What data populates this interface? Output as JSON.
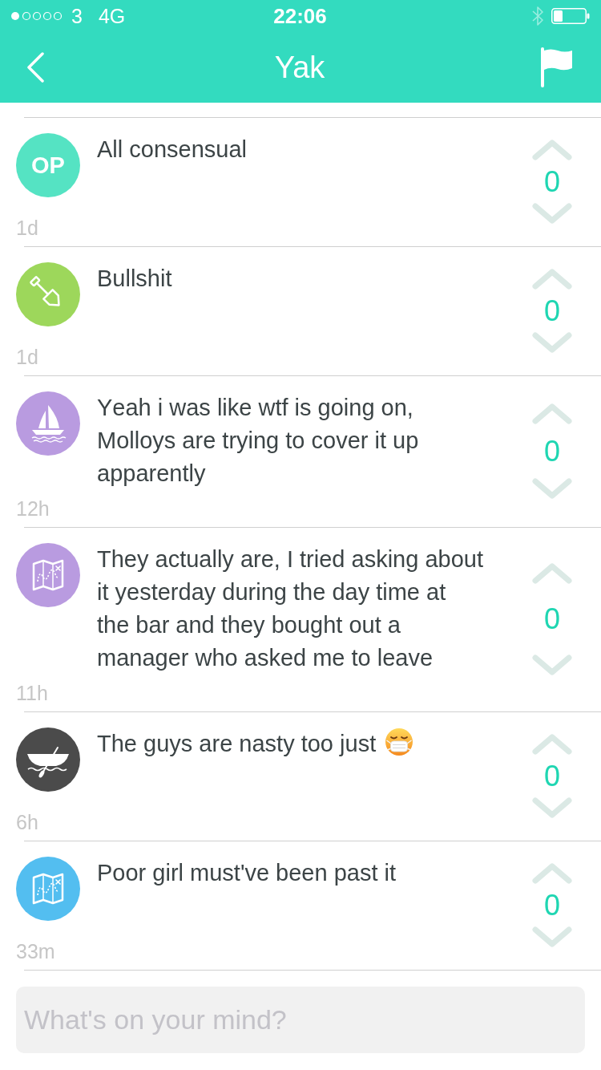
{
  "status_bar": {
    "carrier": "3",
    "network": "4G",
    "time": "22:06"
  },
  "nav_bar": {
    "title": "Yak"
  },
  "posts": [
    {
      "avatar": {
        "kind": "text",
        "label": "OP",
        "color": "#55e3c3"
      },
      "text": "All consensual",
      "time": "1d",
      "votes": "0"
    },
    {
      "avatar": {
        "kind": "shovel",
        "color": "#9dd75b"
      },
      "text": "Bullshit",
      "time": "1d",
      "votes": "0"
    },
    {
      "avatar": {
        "kind": "sailboat",
        "color": "#b99be0"
      },
      "text": "Yeah i was like wtf is going on, Molloys are trying to cover it up apparently",
      "time": "12h",
      "votes": "0"
    },
    {
      "avatar": {
        "kind": "map",
        "color": "#b99be0"
      },
      "text": "They actually are, I tried asking about it yesterday during the day time at the bar and they bought out a manager who asked me to leave",
      "time": "11h",
      "votes": "0"
    },
    {
      "avatar": {
        "kind": "canoe",
        "color": "#4b4b4b"
      },
      "text": "The guys are nasty too just",
      "emoji": {
        "kind": "masked-face"
      },
      "time": "6h",
      "votes": "0"
    },
    {
      "avatar": {
        "kind": "map",
        "color": "#53bef0"
      },
      "text": "Poor girl must've been past it",
      "time": "33m",
      "votes": "0"
    }
  ],
  "composer": {
    "placeholder": "What's on your mind?"
  }
}
